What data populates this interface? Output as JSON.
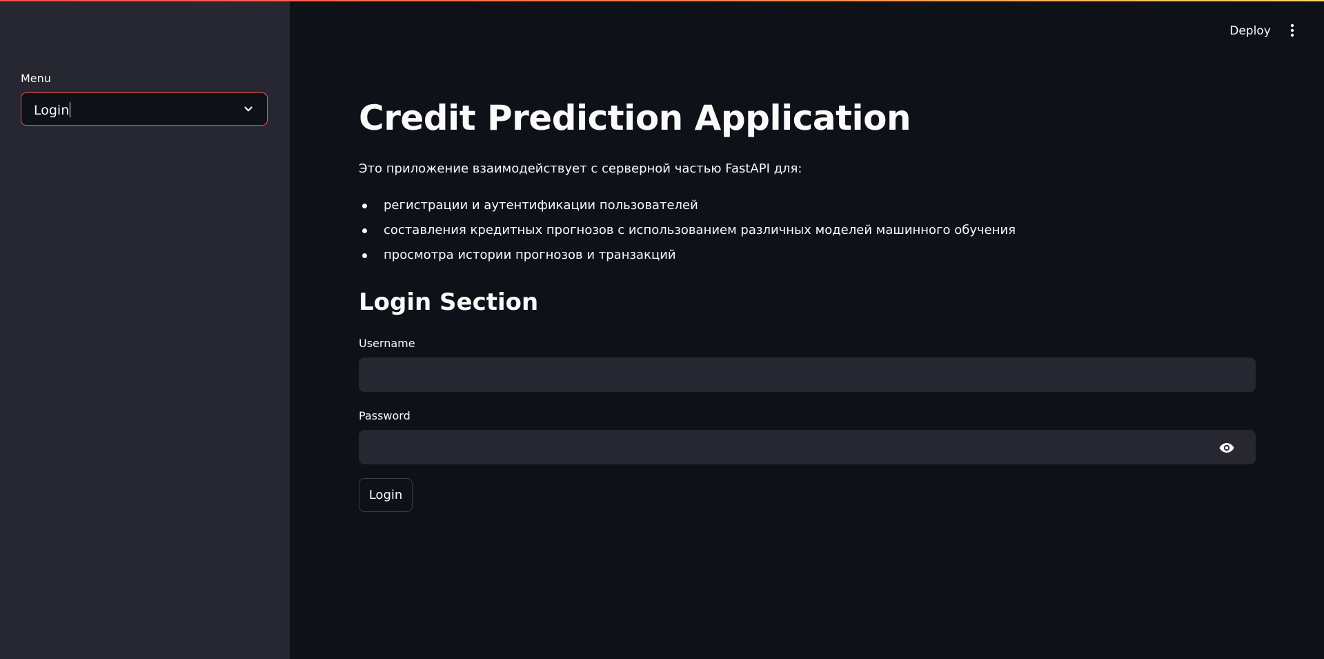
{
  "sidebar": {
    "menu_label": "Menu",
    "menu_selected": "Login"
  },
  "toolbar": {
    "deploy_label": "Deploy"
  },
  "main": {
    "title": "Credit Prediction Application",
    "intro": "Это приложение взаимодействует с серверной частью FastAPI для:",
    "features": [
      "регистрации и аутентификации пользователей",
      "составления кредитных прогнозов с использованием различных моделей машинного обучения",
      "просмотра истории прогнозов и транзакций"
    ],
    "login_section": {
      "title": "Login Section",
      "username_label": "Username",
      "username_value": "",
      "password_label": "Password",
      "password_value": "",
      "submit_label": "Login"
    }
  },
  "colors": {
    "background": "#0e1117",
    "sidebar": "#262730",
    "accent": "#ff4b4b",
    "text": "#fafafa"
  },
  "icons": {
    "dropdown": "chevron-down-icon",
    "toolbar_menu": "vertical-dots-icon",
    "password_toggle": "eye-icon"
  }
}
